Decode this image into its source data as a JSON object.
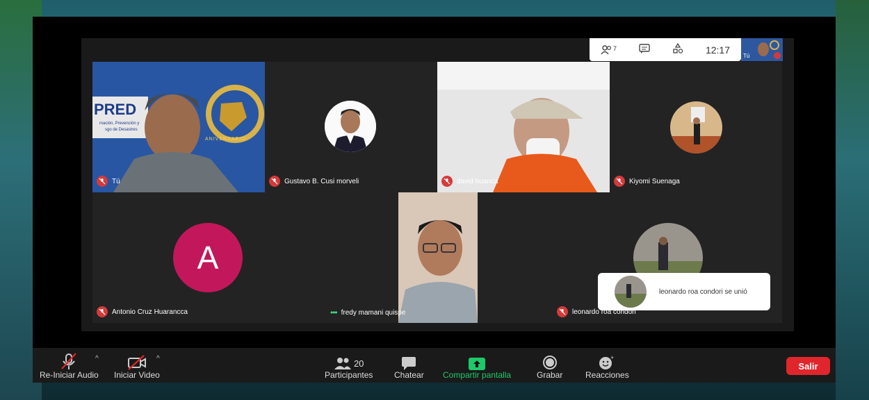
{
  "topbar": {
    "participants_count": "7",
    "time": "12:17"
  },
  "self_thumb_label": "Tú",
  "tiles": {
    "t1_name": "Tú",
    "t2_name": "Gustavo B. Cusi morveli",
    "t3_name": "david huanca",
    "t4_name": "Kiyomi Suenaga",
    "t5_name": "Antonio Cruz Huarancca",
    "t5_letter": "A",
    "t6_name": "fredy mamani quispe",
    "t7_name": "leonardo roa condori"
  },
  "banner": {
    "brand": "PRED",
    "line1": "mación, Prevención y",
    "line2": "sgo de Desastres",
    "ring": "ANIVERSARIO"
  },
  "toast": {
    "text": "leonardo roa condori se unió"
  },
  "toolbar": {
    "audio_label": "Re-Iniciar Audio",
    "video_label": "Iniciar Video",
    "participants_label": "Participantes",
    "participants_count": "20",
    "chat_label": "Chatear",
    "share_label": "Compartir pantalla",
    "record_label": "Grabar",
    "reactions_label": "Reacciones",
    "leave_label": "Salir"
  },
  "colors": {
    "share_green": "#1ec96a",
    "mic_red": "#d53a3a",
    "leave_red": "#e0262c",
    "avatar_a": "#c2185b"
  }
}
